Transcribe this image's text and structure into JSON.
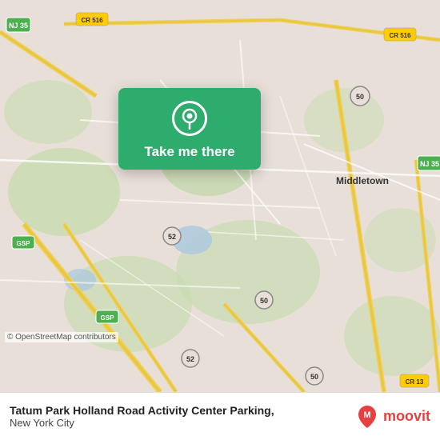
{
  "map": {
    "background_color": "#e8e0d8",
    "copyright": "© OpenStreetMap contributors"
  },
  "action_card": {
    "button_label": "Take me there",
    "icon": "location-pin-icon"
  },
  "bottom_bar": {
    "location_name": "Tatum Park Holland Road Activity Center Parking,",
    "location_subtitle": "New York City",
    "logo_text": "moovit"
  }
}
